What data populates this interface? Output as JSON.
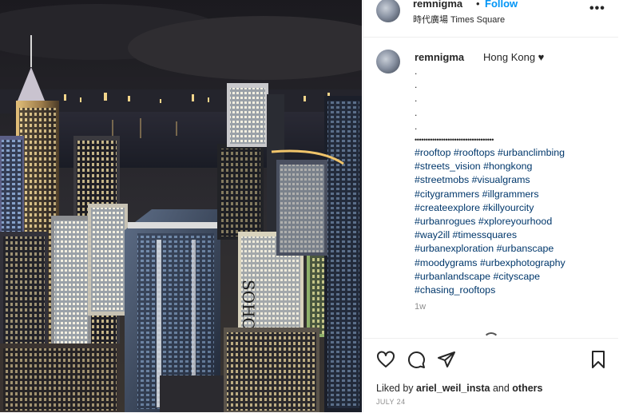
{
  "header": {
    "username": "remnigma",
    "separator": "•",
    "follow_label": "Follow",
    "location": "時代廣場 Times Square",
    "more_icon": "more-horizontal-icon"
  },
  "caption": {
    "username": "remnigma",
    "text": "Hong Kong ♥",
    "dots": [
      ".",
      ".",
      ".",
      ".",
      ".",
      "••••••••••••••••••••••••••••••••••••"
    ],
    "hashtag_lines": [
      "#rooftop #rooftops #urbanclimbing",
      "#streets_vision #hongkong",
      "#streetmobs #visualgrams",
      "#citygrammers #illgrammers",
      "#createexplore #killyourcity",
      "#urbanrogues #xploreyourhood",
      "#way2ill #timessquares",
      "#urbanexploration #urbanscape",
      "#moodygrams #urbexphotography",
      "#urbanlandscape #cityscape",
      "#chasing_rooftops"
    ],
    "time_ago": "1w"
  },
  "actions": {
    "like_icon": "heart-icon",
    "comment_icon": "comment-icon",
    "share_icon": "share-icon",
    "save_icon": "bookmark-icon"
  },
  "likes": {
    "prefix": "Liked by",
    "user": "ariel_weil_insta",
    "joiner": "and",
    "others": "others"
  },
  "date": "JULY 24",
  "colors": {
    "follow": "#0095f6",
    "hashtag": "#00376b",
    "text": "#262626",
    "muted": "#8e8e8e"
  }
}
